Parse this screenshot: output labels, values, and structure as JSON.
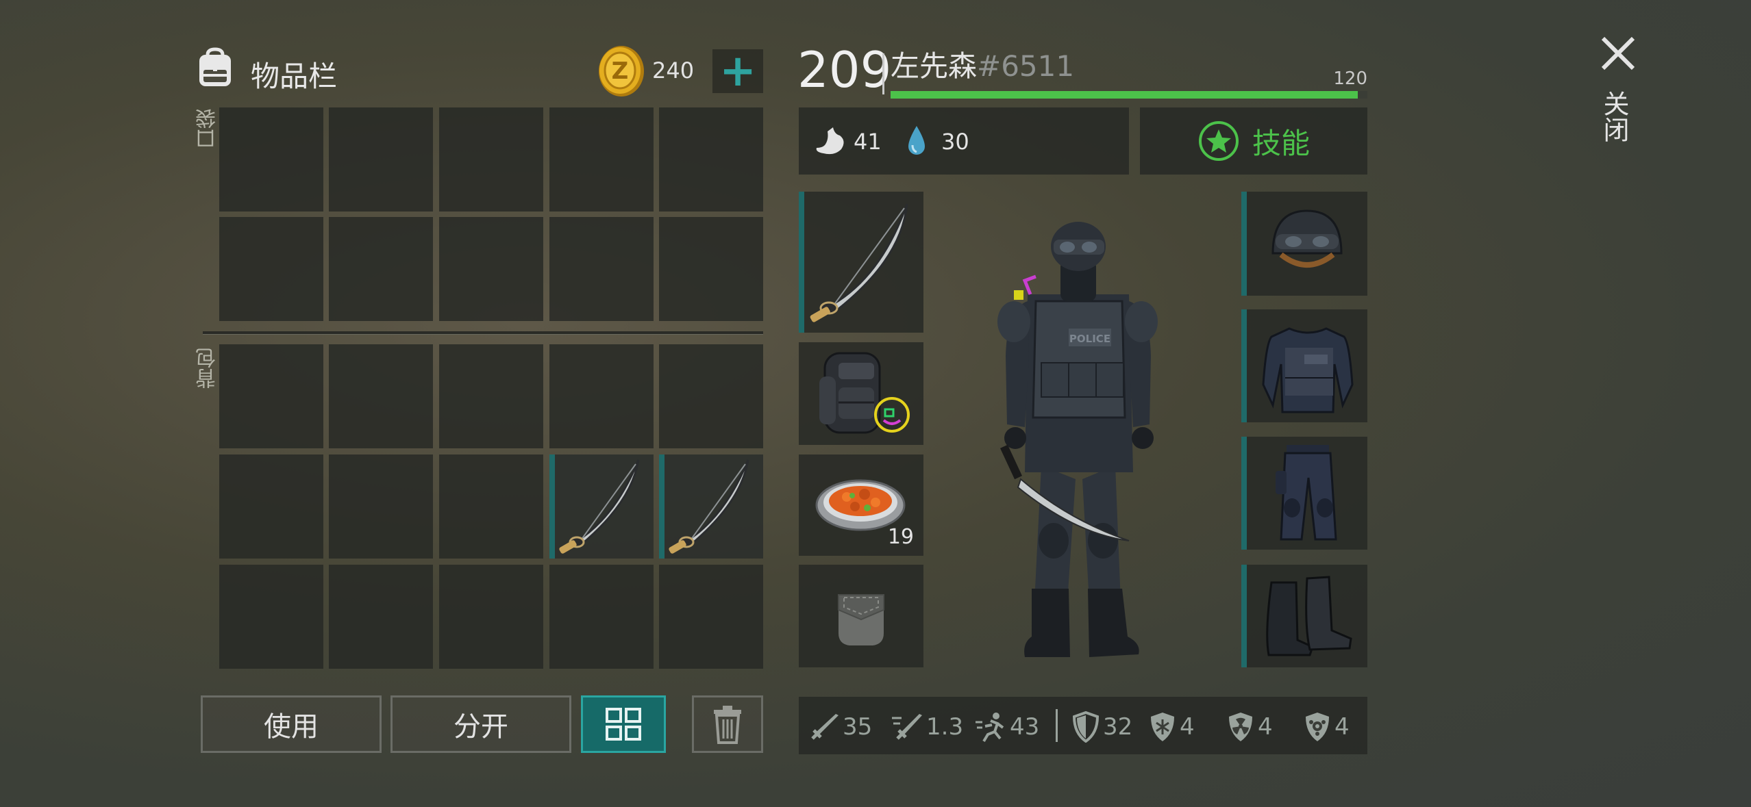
{
  "inventory": {
    "title": "物品栏",
    "coins": "240",
    "add_symbol": "+",
    "pocket_label": "口袋",
    "backpack_label": "背包"
  },
  "actions": {
    "use_label": "使用",
    "split_label": "分开"
  },
  "player": {
    "level": "209",
    "name": "左先森",
    "tag": "#6511",
    "xp_max": "120",
    "xp_progress": 0.98,
    "hunger": "41",
    "thirst": "30",
    "skills_label": "技能",
    "food_count": "19"
  },
  "close_label": "关闭",
  "stats": {
    "attack": "35",
    "attack_speed": "1.3",
    "speed": "43",
    "defense": "32",
    "cold_res": "4",
    "radiation_res": "4",
    "infection_res": "4"
  },
  "colors": {
    "accent_green": "#4cc24a",
    "teal": "#1f8a87",
    "coin_gold": "#e4ae1f"
  }
}
